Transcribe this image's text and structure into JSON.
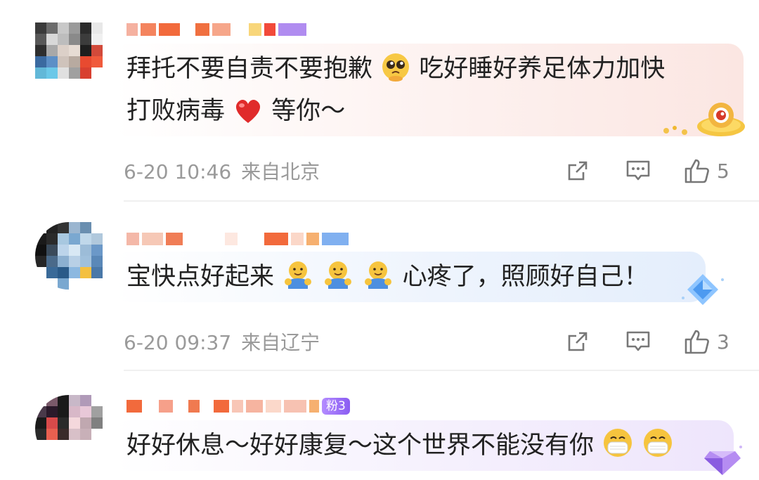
{
  "comments": [
    {
      "text_parts": [
        "拜托不要自责不要抱歉",
        "吃好睡好养足体力加快",
        "打败病毒",
        "等你～"
      ],
      "date": "6-20 10:46",
      "location": "来自北京",
      "like_count": "5",
      "bubble_color": "#fdf0ee"
    },
    {
      "text_parts": [
        "宝快点好起来",
        "心疼了，照顾好自己！"
      ],
      "date": "6-20 09:37",
      "location": "来自辽宁",
      "like_count": "3",
      "bubble_color": "#eef4fc"
    },
    {
      "text_parts": [
        "好好休息～好好康复～这个世界不能没有你"
      ],
      "fan_badge": "粉3",
      "bubble_color": "#f4effc"
    }
  ],
  "icons": {
    "share": "share-icon",
    "comment": "comment-icon",
    "like": "thumbs-up-icon"
  }
}
